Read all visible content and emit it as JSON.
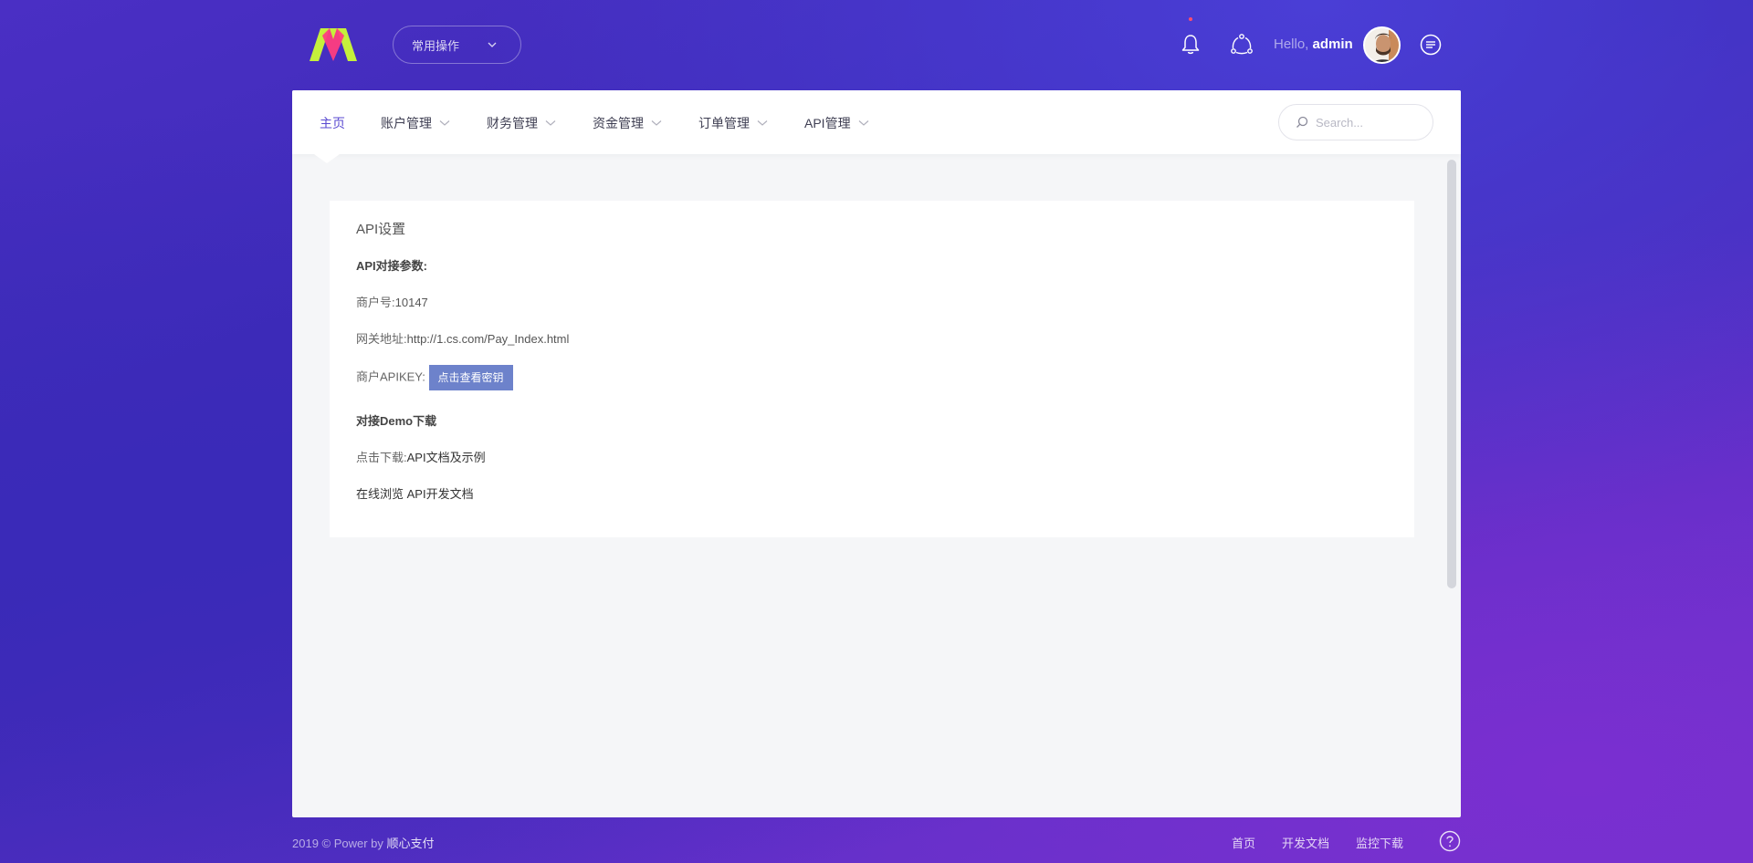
{
  "header": {
    "quick_ops_label": "常用操作",
    "hello_prefix": "Hello,",
    "username": "admin"
  },
  "nav": {
    "items": [
      {
        "label": "主页",
        "active": true
      },
      {
        "label": "账户管理"
      },
      {
        "label": "财务管理"
      },
      {
        "label": "资金管理"
      },
      {
        "label": "订单管理"
      },
      {
        "label": "API管理"
      }
    ],
    "search_placeholder": "Search..."
  },
  "card": {
    "title": "API设置",
    "params_heading": "API对接参数:",
    "merchant_label": "商户号:",
    "merchant_value": "10147",
    "gateway_label": "网关地址:",
    "gateway_value": "http://1.cs.com/Pay_Index.html",
    "apikey_label": "商户APIKEY:",
    "apikey_button": "点击查看密钥",
    "demo_heading": "对接Demo下载",
    "download_label": "点击下载:",
    "download_link": "API文档及示例",
    "online_doc": "在线浏览 API开发文档"
  },
  "footer": {
    "copyright": "2019 © Power by",
    "brand": "顺心支付",
    "links": [
      "首页",
      "开发文档",
      "监控下载"
    ]
  },
  "colors": {
    "accent": "#5a4ad1",
    "button": "#6d82cb",
    "logo_green": "#c5f03c",
    "logo_pink": "#ff3d7f"
  },
  "icons": [
    "logo-icon",
    "chevron-down-icon",
    "bell-icon",
    "sync-icon",
    "menu-lines-icon",
    "search-icon",
    "help-icon"
  ]
}
